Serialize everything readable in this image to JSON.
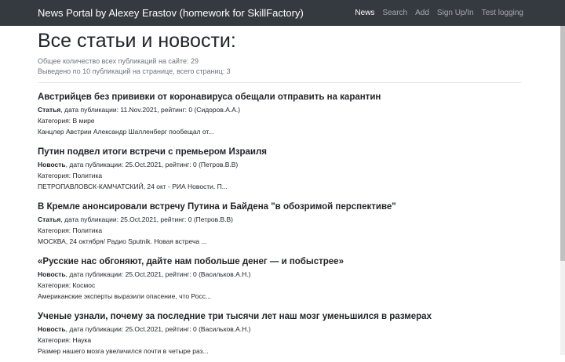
{
  "navbar": {
    "brand": "News Portal by Alexey Erastov (homework for SkillFactory)",
    "links": [
      {
        "label": "News",
        "active": true
      },
      {
        "label": "Search",
        "active": false
      },
      {
        "label": "Add",
        "active": false
      },
      {
        "label": "Sign Up/In",
        "active": false
      },
      {
        "label": "Test logging",
        "active": false
      }
    ]
  },
  "page": {
    "title": "Все статьи и новости:",
    "total_line": "Общее количество всех публикаций на сайте: 29",
    "shown_line": "Выведено по 10 публикаций на странице, всего страниц: 3"
  },
  "articles": [
    {
      "title": "Австрийцев без прививки от коронавируса обещали отправить на карантин",
      "type": "Статья",
      "meta_rest": ", дата публикации: 11.Nov.2021, рейтинг: 0 (Сидоров.А.А.)",
      "category": "Категория: В мире",
      "excerpt": "Канцлер Австрии Александр Шалленберг пообещал от..."
    },
    {
      "title": "Путин подвел итоги встречи с премьером Израиля",
      "type": "Новость",
      "meta_rest": ", дата публикации: 25.Oct.2021, рейтинг: 0 (Петров.В.В)",
      "category": "Категория: Политика",
      "excerpt": "ПЕТРОПАВЛОВСК-КАМЧАТСКИЙ, 24 окт - РИА Новости. П..."
    },
    {
      "title": "В Кремле анонсировали встречу Путина и Байдена \"в обозримой перспективе\"",
      "type": "Статья",
      "meta_rest": ", дата публикации: 25.Oct.2021, рейтинг: 0 (Петров.В.В)",
      "category": "Категория: Политика",
      "excerpt": "МОСКВА, 24 октября/ Радио Sputnik. Новая встреча ..."
    },
    {
      "title": "«Русские нас обгоняют, дайте нам побольше денег — и побыстрее»",
      "type": "Новость",
      "meta_rest": ", дата публикации: 25.Oct.2021, рейтинг: 0 (Васильков.А.Н.)",
      "category": "Категория: Космос",
      "excerpt": "Американские эксперты выразили опасение, что Росс..."
    },
    {
      "title": "Ученые узнали, почему за последние три тысячи лет наш мозг уменьшился в размерах",
      "type": "Новость",
      "meta_rest": ", дата публикации: 25.Oct.2021, рейтинг: 0 (Васильков.А.Н.)",
      "category": "Категория: Наука",
      "excerpt": "Размер нашего мозга увеличился почти в четыре раз..."
    }
  ]
}
